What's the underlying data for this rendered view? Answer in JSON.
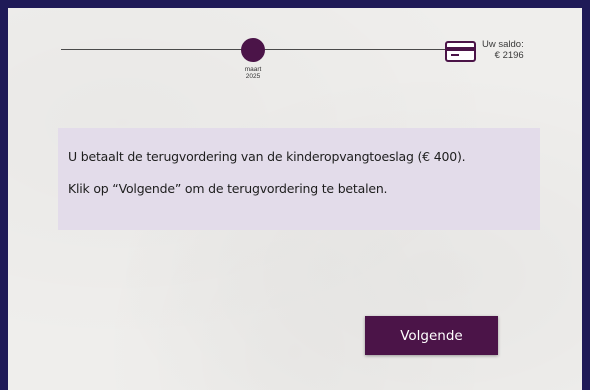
{
  "timeline": {
    "current_month": "maart",
    "current_year": "2025"
  },
  "balance": {
    "label": "Uw saldo:",
    "amount": "€ 2196",
    "icon": "credit-card-icon"
  },
  "message": {
    "line1": "U betaalt de terugvordering van de kinderopvangtoeslag (€ 400).",
    "line2": "Klik op “Volgende” om de terugvordering te betalen."
  },
  "actions": {
    "next_label": "Volgende"
  },
  "colors": {
    "accent": "#4b1448",
    "frame_border": "#1f1a57",
    "message_background": "#e3dcea",
    "page_background": "#efeeec"
  }
}
